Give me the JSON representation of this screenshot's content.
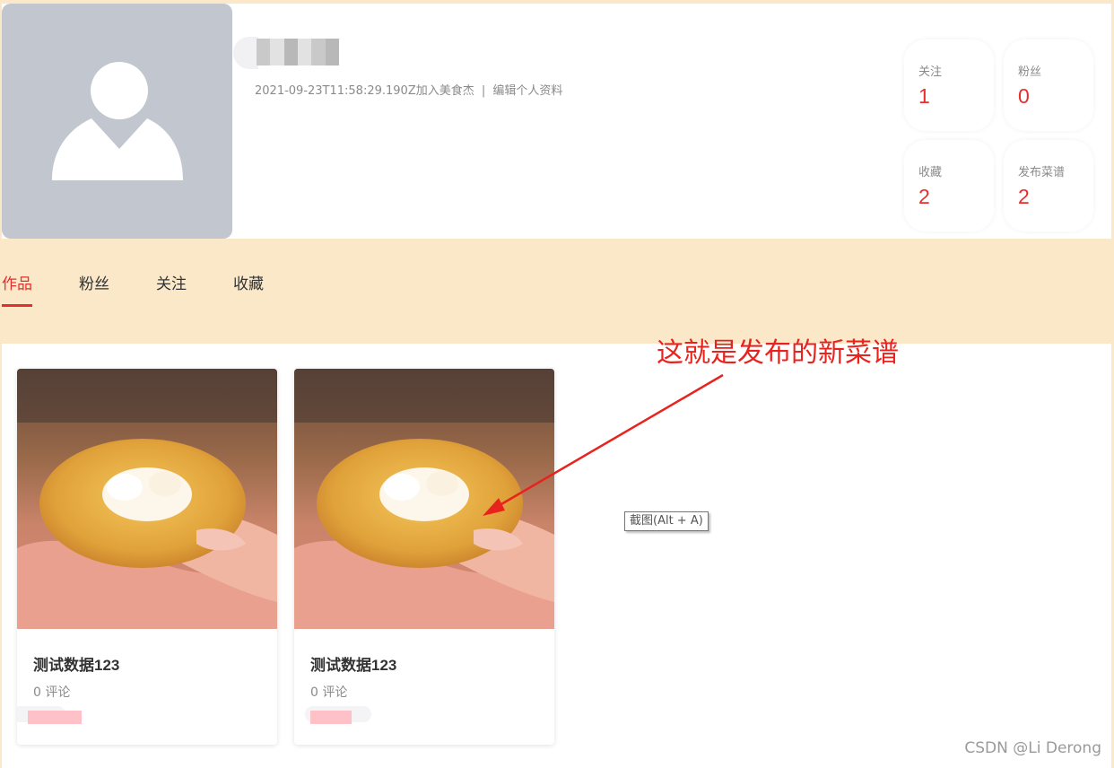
{
  "profile": {
    "username": "",
    "joined_text": "2021-09-23T11:58:29.190Z加入美食杰",
    "separator": "|",
    "edit_label": "编辑个人资料"
  },
  "stats": [
    {
      "label": "关注",
      "value": "1"
    },
    {
      "label": "粉丝",
      "value": "0"
    },
    {
      "label": "收藏",
      "value": "2"
    },
    {
      "label": "发布菜谱",
      "value": "2"
    }
  ],
  "tabs": [
    {
      "label": "作品",
      "active": true
    },
    {
      "label": "粉丝",
      "active": false
    },
    {
      "label": "关注",
      "active": false
    },
    {
      "label": "收藏",
      "active": false
    }
  ],
  "cards": [
    {
      "title": "测试数据123",
      "comments": "0 评论"
    },
    {
      "title": "测试数据123",
      "comments": "0 评论"
    }
  ],
  "annotation": "这就是发布的新菜谱",
  "tooltip": "截图(Alt + A)",
  "watermark": "CSDN @Li Derong",
  "colors": {
    "accent": "#e52e2e",
    "page_background": "#fae8c9",
    "annotation": "#e8231e",
    "avatar_placeholder": "#c2c6cf"
  }
}
